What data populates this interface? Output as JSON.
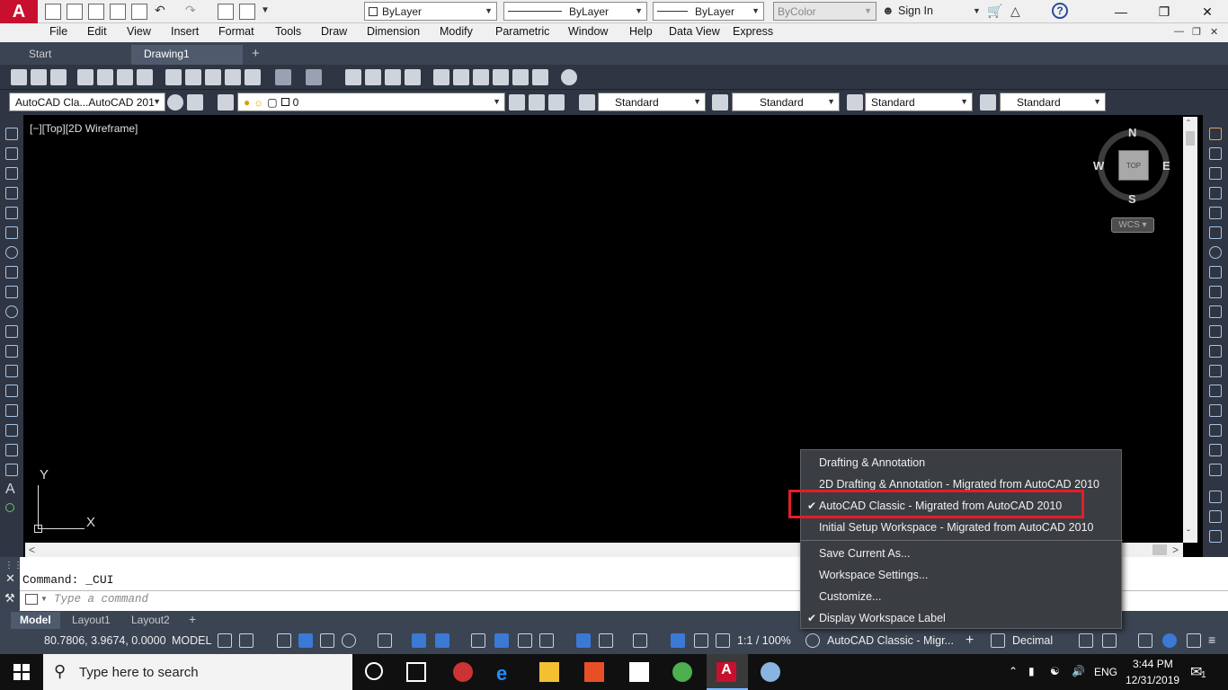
{
  "titlebar": {
    "layer_combo": "ByLayer",
    "linetype_combo": "ByLayer",
    "lineweight_combo": "ByLayer",
    "color_combo": "ByColor",
    "sign_in": "Sign In"
  },
  "menubar": {
    "items": [
      "File",
      "Edit",
      "View",
      "Insert",
      "Format",
      "Tools",
      "Draw",
      "Dimension",
      "Modify",
      "Parametric",
      "Window",
      "Help",
      "Data View",
      "Express"
    ]
  },
  "tabs": {
    "start": "Start",
    "drawing": "Drawing1",
    "add": "+"
  },
  "toolbar2": {
    "workspace_combo": "AutoCAD Cla...AutoCAD 201",
    "layer_name": "0",
    "text_style": "Standard",
    "dim_style": "Standard",
    "table_style": "Standard",
    "mleader_style": "Standard"
  },
  "viewport": {
    "label": "[−][Top][2D Wireframe]",
    "compass": {
      "n": "N",
      "s": "S",
      "e": "E",
      "w": "W"
    },
    "cube_face": "TOP",
    "wcs": "WCS",
    "ucs_x": "X",
    "ucs_y": "Y"
  },
  "command": {
    "history": "Command: _CUI",
    "placeholder": "Type a command"
  },
  "layouts": {
    "model": "Model",
    "layout1": "Layout1",
    "layout2": "Layout2",
    "add": "+"
  },
  "statusbar": {
    "coords": "80.7806, 3.9674, 0.0000",
    "model": "MODEL",
    "scale": "1:1 / 100%",
    "workspace": "AutoCAD Classic - Migr...",
    "units": "Decimal"
  },
  "workspace_menu": {
    "items": [
      {
        "label": "Drafting & Annotation",
        "checked": false
      },
      {
        "label": "2D Drafting & Annotation - Migrated from AutoCAD 2010",
        "checked": false
      },
      {
        "label": "AutoCAD Classic - Migrated from AutoCAD 2010",
        "checked": true
      },
      {
        "label": "Initial Setup Workspace - Migrated from AutoCAD 2010",
        "checked": false
      }
    ],
    "actions": [
      {
        "label": "Save Current As...",
        "checked": false
      },
      {
        "label": "Workspace Settings...",
        "checked": false
      },
      {
        "label": "Customize...",
        "checked": false
      },
      {
        "label": "Display Workspace Label",
        "checked": true
      }
    ],
    "highlight_color": "#e31e2a"
  },
  "taskbar": {
    "search_placeholder": "Type here to search",
    "lang": "ENG",
    "time": "3:44 PM",
    "date": "12/31/2019",
    "notifications": "1"
  }
}
